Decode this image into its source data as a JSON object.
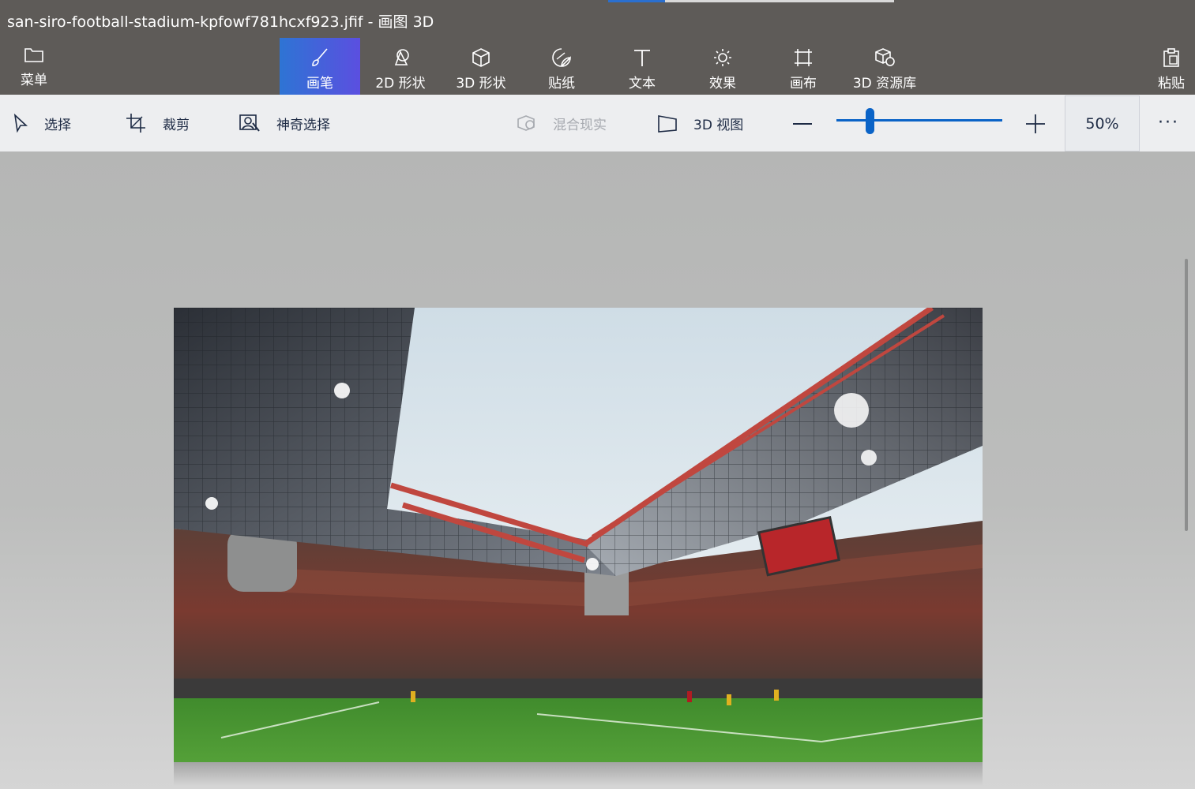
{
  "window": {
    "title": "san-siro-football-stadium-kpfowf781hcxf923.jfif - 画图 3D"
  },
  "title_progress": {
    "fraction": 0.2
  },
  "ribbon": {
    "menu": {
      "label": "菜单",
      "icon": "folder-icon"
    },
    "tabs": [
      {
        "label": "画笔",
        "icon": "brush-icon",
        "active": true
      },
      {
        "label": "2D 形状",
        "icon": "2d-shapes-icon"
      },
      {
        "label": "3D 形状",
        "icon": "3d-cube-icon"
      },
      {
        "label": "贴纸",
        "icon": "sticker-icon"
      },
      {
        "label": "文本",
        "icon": "text-icon"
      },
      {
        "label": "效果",
        "icon": "sun-effects-icon"
      },
      {
        "label": "画布",
        "icon": "canvas-icon"
      },
      {
        "label": "3D 资源库",
        "icon": "3d-library-icon"
      }
    ],
    "paste": {
      "label": "粘贴",
      "icon": "clipboard-icon"
    }
  },
  "toolbar": {
    "select": "选择",
    "crop": "裁剪",
    "magic_select": "神奇选择",
    "mixed_reality": "混合现实",
    "view_3d": "3D 视图",
    "zoom_level": "50%",
    "zoom_fraction": 0.2,
    "more": "···"
  },
  "colors": {
    "titlebar": "#5e5b58",
    "active_tab_start": "#2e74d4",
    "active_tab_end": "#5b4fe0",
    "slider": "#0a63c7",
    "toolbar_bg": "#edeef0"
  }
}
